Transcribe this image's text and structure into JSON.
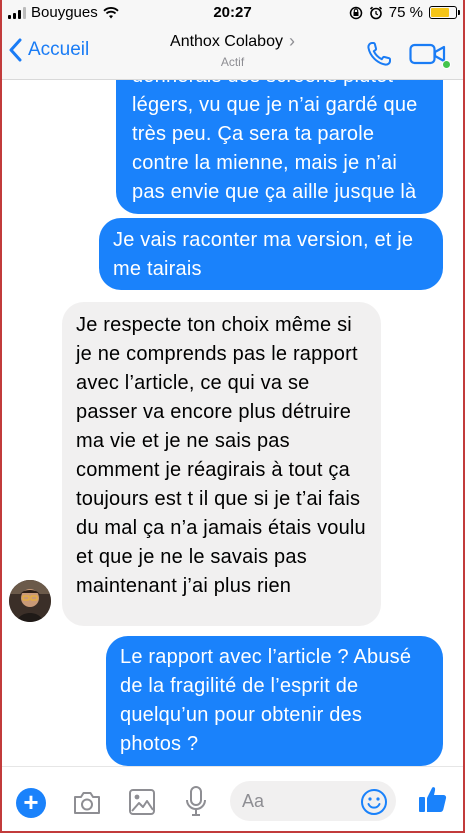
{
  "status_bar": {
    "carrier": "Bouygues",
    "time": "20:27",
    "battery_percent": "75 %",
    "battery_level": 0.75
  },
  "header": {
    "back_label": "Accueil",
    "contact_name": "Anthox Colaboy",
    "contact_status": "Actif",
    "accent_color": "#1a7cf5",
    "online_color": "#44c44c"
  },
  "messages": [
    {
      "direction": "outgoing",
      "text": "donnerais des screens plutôt légers, vu que je n’ai gardé que très peu. Ça sera ta parole contre la mienne, mais je n’ai pas envie que ça aille jusque là"
    },
    {
      "direction": "outgoing",
      "text": "Je vais raconter ma version, et je me tairais"
    },
    {
      "direction": "incoming",
      "text": "Je respecte ton choix même si je ne comprends pas le rapport avec l’article, ce qui va se passer va encore plus détruire ma vie et je ne sais pas comment je réagirais à tout ça toujours est t il que si je t’ai fais du mal ça n’a jamais étais voulu et que je ne le savais pas maintenant j’ai plus rien"
    },
    {
      "direction": "outgoing",
      "text": "Le rapport avec l’article ? Abusé de la fragilité de l’esprit de quelqu’un pour obtenir des photos ?"
    }
  ],
  "composer": {
    "placeholder": "Aa"
  },
  "colors": {
    "outgoing_bubble": "#1a82fb",
    "incoming_bubble": "#f1f0f0"
  },
  "icons": [
    "signal-icon",
    "wifi-icon",
    "lock-rotation-icon",
    "alarm-icon",
    "battery-icon",
    "back-chevron-icon",
    "phone-icon",
    "video-icon",
    "plus-icon",
    "camera-icon",
    "image-icon",
    "microphone-icon",
    "emoji-icon",
    "thumbs-up-icon"
  ]
}
